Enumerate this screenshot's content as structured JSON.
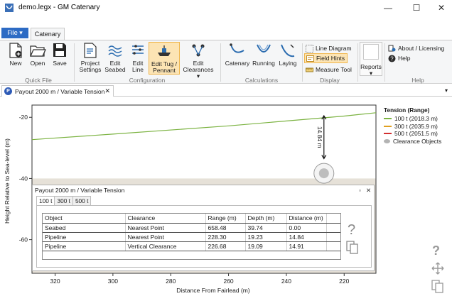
{
  "window": {
    "title": "demo.legx - GM Catenary",
    "minimize": "—",
    "maximize": "☐",
    "close": "✕"
  },
  "ribbon_tabs": {
    "file": "File ▾",
    "catenary": "Catenary"
  },
  "ribbon": {
    "quick_file": {
      "label": "Quick File",
      "new": "New",
      "open": "Open",
      "save": "Save"
    },
    "configuration": {
      "label": "Configuration",
      "project_settings": [
        "Project",
        "Settings"
      ],
      "edit_seabed": [
        "Edit",
        "Seabed"
      ],
      "edit_line": [
        "Edit",
        "Line"
      ],
      "edit_tug": [
        "Edit Tug /",
        "Pennant"
      ],
      "edit_clearances": [
        "Edit",
        "Clearances ▾"
      ]
    },
    "calculations": {
      "label": "Calculations",
      "catenary": "Catenary",
      "running": "Running",
      "laying": "Laying"
    },
    "display": {
      "label": "Display",
      "line_diagram": "Line Diagram",
      "field_hints": "Field Hints",
      "measure_tool": "Measure Tool"
    },
    "reports": {
      "label": "Reports ▾"
    },
    "help": {
      "label": "Help",
      "about": "About / Licensing",
      "help": "Help"
    }
  },
  "document_tab": {
    "icon_letter": "P",
    "title": "Payout 2000 m / Variable Tension",
    "close": "✕",
    "menu": "▾"
  },
  "plot": {
    "ylabel": "Height Relative to Sea-level (m)",
    "xlabel": "Distance From Fairlead (m)",
    "measure_label": "14.84 m",
    "help_icon": "?",
    "colors": {
      "line_100": "#7cb342",
      "line_300": "#e0a020",
      "line_500": "#d32f2f",
      "seabed_band": "#e6e1d8",
      "clearance": "#bdbdbd"
    }
  },
  "chart_data": {
    "type": "line",
    "xlabel": "Distance From Fairlead (m)",
    "ylabel": "Height Relative to Sea-level (m)",
    "x_reversed": true,
    "xlim": [
      328,
      209
    ],
    "ylim": [
      -71,
      -16
    ],
    "x_ticks": [
      320,
      300,
      280,
      260,
      240,
      220
    ],
    "y_ticks": [
      -20,
      -40,
      -60
    ],
    "series": [
      {
        "name": "100 t (2018.3 m)",
        "x": [
          328,
          300,
          260,
          220,
          209
        ],
        "y": [
          -27.3,
          -25.5,
          -22.8,
          -19.6,
          -18.5
        ]
      }
    ],
    "seabed_level": -40,
    "clearance_object": {
      "x": 227,
      "y": -38.3
    },
    "measurement": {
      "x": 227,
      "from": -19.5,
      "to": -33.5,
      "label": "14.84 m"
    },
    "legend": {
      "title": "Tension (Range)",
      "entries": [
        "100 t (2018.3 m)",
        "300 t (2035.9 m)",
        "500 t (2051.5 m)",
        "Clearance Objects"
      ],
      "position": "right"
    }
  },
  "panel": {
    "title": "Payout 2000 m / Variable Tension",
    "restore": "▫",
    "close": "✕",
    "tabs": [
      "100 t",
      "300 t",
      "500 t"
    ],
    "selected_tab": "100 t",
    "table": {
      "headers": [
        "Object",
        "Clearance",
        "Range (m)",
        "Depth (m)",
        "Distance (m)"
      ],
      "rows": [
        [
          "Seabed",
          "Nearest Point",
          "658.48",
          "39.74",
          "0.00"
        ],
        [
          "Pipeline",
          "Nearest Point",
          "228.30",
          "19.23",
          "14.84"
        ],
        [
          "Pipeline",
          "Vertical Clearance",
          "226.68",
          "19.09",
          "14.91"
        ]
      ]
    },
    "help_icon": "?"
  }
}
